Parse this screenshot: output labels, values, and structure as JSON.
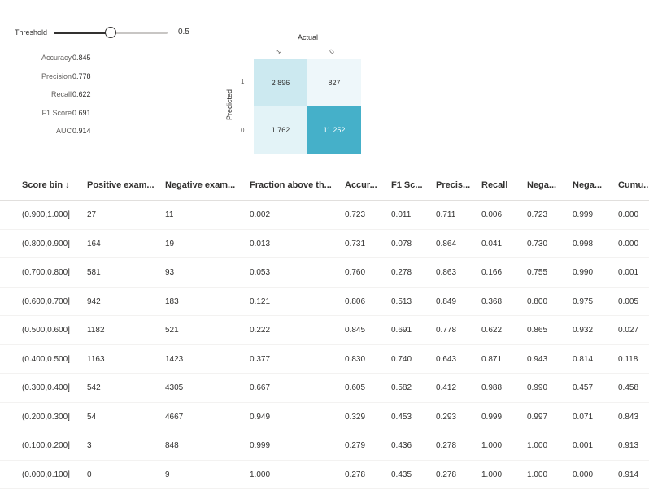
{
  "threshold": {
    "label": "Threshold",
    "value": "0.5",
    "level": 0.5
  },
  "metrics": [
    {
      "label": "Accuracy",
      "value": "0.845"
    },
    {
      "label": "Precision",
      "value": "0.778"
    },
    {
      "label": "Recall",
      "value": "0.622"
    },
    {
      "label": "F1 Score",
      "value": "0.691"
    },
    {
      "label": "AUC",
      "value": "0.914"
    }
  ],
  "confusion_matrix": {
    "actual_label": "Actual",
    "predicted_label": "Predicted",
    "col_ticks": [
      "1",
      "0"
    ],
    "row_ticks": [
      "1",
      "0"
    ],
    "cells": [
      [
        "2 896",
        "827"
      ],
      [
        "1 762",
        "11 252"
      ]
    ],
    "colors": {
      "tp": "#cce9f0",
      "fp": "#eef7fa",
      "fn": "#e3f3f7",
      "tn": "#45b0c9"
    }
  },
  "table": {
    "headers": [
      "Score bin ↓",
      "Positive exam...",
      "Negative exam...",
      "Fraction above th...",
      "Accur...",
      "F1 Sc...",
      "Precis...",
      "Recall",
      "Nega...",
      "Nega...",
      "Cumu..."
    ],
    "rows": [
      [
        "(0.900,1.000]",
        "27",
        "11",
        "0.002",
        "0.723",
        "0.011",
        "0.711",
        "0.006",
        "0.723",
        "0.999",
        "0.000"
      ],
      [
        "(0.800,0.900]",
        "164",
        "19",
        "0.013",
        "0.731",
        "0.078",
        "0.864",
        "0.041",
        "0.730",
        "0.998",
        "0.000"
      ],
      [
        "(0.700,0.800]",
        "581",
        "93",
        "0.053",
        "0.760",
        "0.278",
        "0.863",
        "0.166",
        "0.755",
        "0.990",
        "0.001"
      ],
      [
        "(0.600,0.700]",
        "942",
        "183",
        "0.121",
        "0.806",
        "0.513",
        "0.849",
        "0.368",
        "0.800",
        "0.975",
        "0.005"
      ],
      [
        "(0.500,0.600]",
        "1182",
        "521",
        "0.222",
        "0.845",
        "0.691",
        "0.778",
        "0.622",
        "0.865",
        "0.932",
        "0.027"
      ],
      [
        "(0.400,0.500]",
        "1163",
        "1423",
        "0.377",
        "0.830",
        "0.740",
        "0.643",
        "0.871",
        "0.943",
        "0.814",
        "0.118"
      ],
      [
        "(0.300,0.400]",
        "542",
        "4305",
        "0.667",
        "0.605",
        "0.582",
        "0.412",
        "0.988",
        "0.990",
        "0.457",
        "0.458"
      ],
      [
        "(0.200,0.300]",
        "54",
        "4667",
        "0.949",
        "0.329",
        "0.453",
        "0.293",
        "0.999",
        "0.997",
        "0.071",
        "0.843"
      ],
      [
        "(0.100,0.200]",
        "3",
        "848",
        "0.999",
        "0.279",
        "0.436",
        "0.278",
        "1.000",
        "1.000",
        "0.001",
        "0.913"
      ],
      [
        "(0.000,0.100]",
        "0",
        "9",
        "1.000",
        "0.278",
        "0.435",
        "0.278",
        "1.000",
        "1.000",
        "0.000",
        "0.914"
      ]
    ]
  }
}
